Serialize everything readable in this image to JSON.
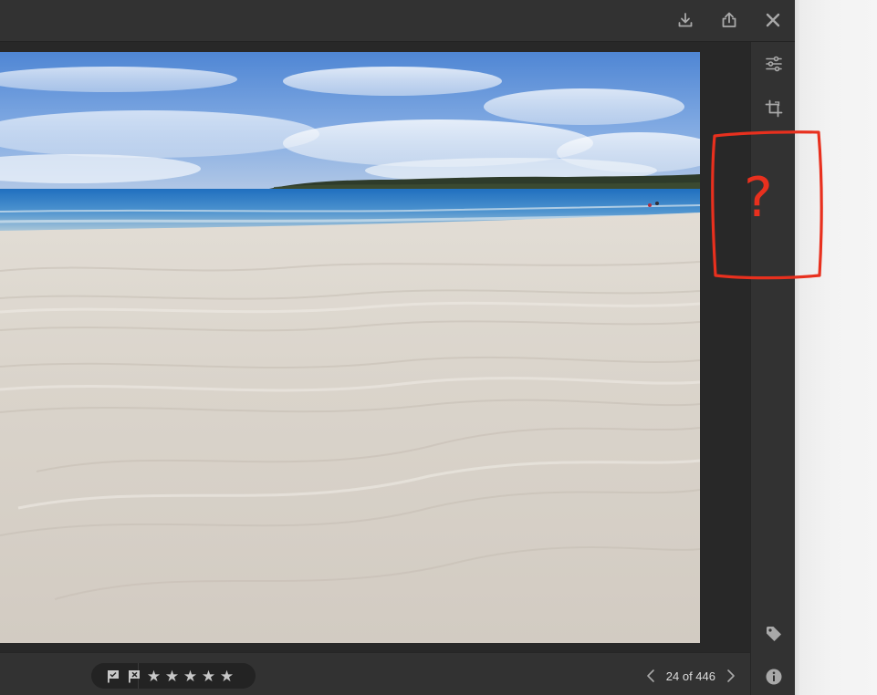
{
  "toolbar": {
    "icons": [
      "download-icon",
      "share-icon",
      "close-icon"
    ]
  },
  "photo": {
    "subject": "beach-landscape"
  },
  "sidebar": {
    "icons": [
      "edit-sliders-icon",
      "crop-icon",
      "tag-icon",
      "info-icon"
    ]
  },
  "annotation": {
    "mark": "?",
    "color": "#e8301e"
  },
  "bottombar": {
    "flag_icons": [
      "pick-flag-icon",
      "reject-flag-icon"
    ],
    "stars": [
      "★",
      "★",
      "★",
      "★",
      "★"
    ],
    "pager": {
      "label": "24 of 446",
      "prev_icon": "chevron-left-icon",
      "next_icon": "chevron-right-icon"
    }
  },
  "colors": {
    "chrome": "#2c2c2c",
    "panel": "#323232",
    "icon": "#a9a9a9",
    "text": "#dcdcdc",
    "accent_annotation": "#e8301e"
  }
}
